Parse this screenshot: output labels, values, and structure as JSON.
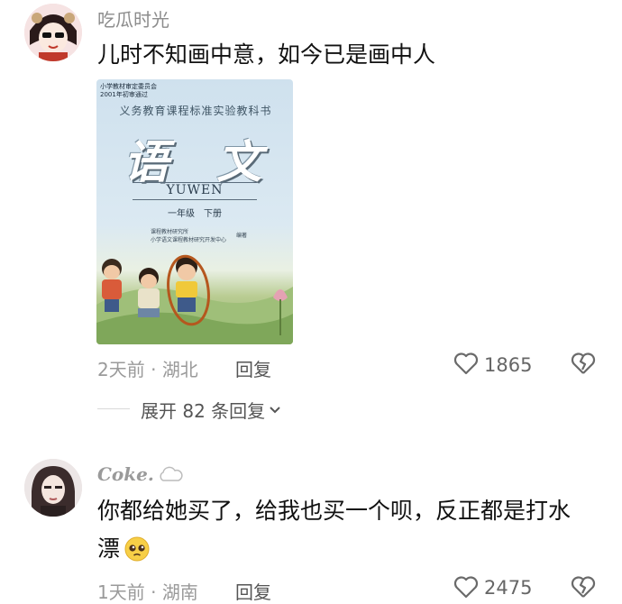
{
  "comments": [
    {
      "username": "吃瓜时光",
      "text": "儿时不知画中意，如今已是画中人",
      "time": "2天前",
      "sep": "·",
      "location": "湖北",
      "reply_label": "回复",
      "likes": "1865",
      "image": {
        "badge_line1": "小学教材审定委员会",
        "badge_line2": "2001年初审通过",
        "series": "义务教育课程标准实验教科书",
        "title": "语 文",
        "pinyin": "YUWEN",
        "grade": "一年级　下册",
        "publisher1": "课程教材研究所",
        "publisher2": "小学语文课程教材研究开发中心",
        "publisher3": "编著"
      },
      "expand_replies": "展开 82 条回复"
    },
    {
      "username": "Coke.",
      "text_line1": "你都给她买了，给我也买一个呗，反正都是打水",
      "text_line2": "漂",
      "time": "1天前",
      "sep": "·",
      "location": "湖南",
      "reply_label": "回复",
      "likes": "2475"
    }
  ],
  "icons": {
    "like": "heart-outline-icon",
    "dislike": "broken-heart-icon",
    "expand": "chevron-down-icon",
    "cloud": "cloud-icon",
    "emoji": "pleading-face-emoji-icon"
  },
  "colors": {
    "text": "#111111",
    "meta": "#9a9a9a",
    "divider": "#d9d9d9",
    "circle_annotation": "#b5571e"
  }
}
